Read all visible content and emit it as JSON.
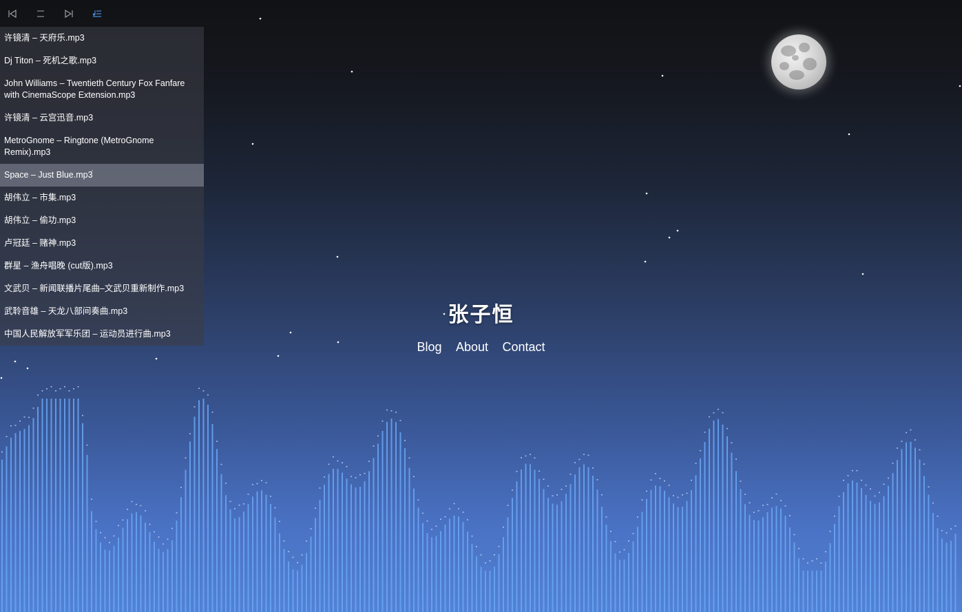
{
  "player": {
    "controls": [
      {
        "name": "previous-icon",
        "icon": "prev"
      },
      {
        "name": "pause-icon",
        "icon": "pause"
      },
      {
        "name": "next-icon",
        "icon": "next"
      },
      {
        "name": "playlist-icon",
        "icon": "playlist"
      }
    ],
    "accent_color": "#4a8fe8",
    "tracks": [
      "许镜清 – 天府乐.mp3",
      "Dj Titon – 死机之歌.mp3",
      "John Williams – Twentieth Century Fox Fanfare with CinemaScope Extension.mp3",
      "许镜清 – 云宫迅音.mp3",
      "MetroGnome – Ringtone (MetroGnome Remix).mp3",
      "Space – Just Blue.mp3",
      "胡伟立 – 市集.mp3",
      "胡伟立 – 偷功.mp3",
      "卢冠廷 – 赌神.mp3",
      "群星 – 渔舟唱晚 (cut版).mp3",
      "文武贝 – 新闻联播片尾曲–文武贝重新制作.mp3",
      "武聆音雄 – 天龙八部间奏曲.mp3",
      "中国人民解放军军乐团 – 运动员进行曲.mp3"
    ],
    "active_track": "Space – Just Blue.mp3"
  },
  "site": {
    "title": "张子恒",
    "nav": {
      "blog": "Blog",
      "about": "About",
      "contact": "Contact"
    }
  },
  "colors": {
    "visualizer_bar": "#6aa6f5",
    "visualizer_cap": "#c8dcff"
  }
}
